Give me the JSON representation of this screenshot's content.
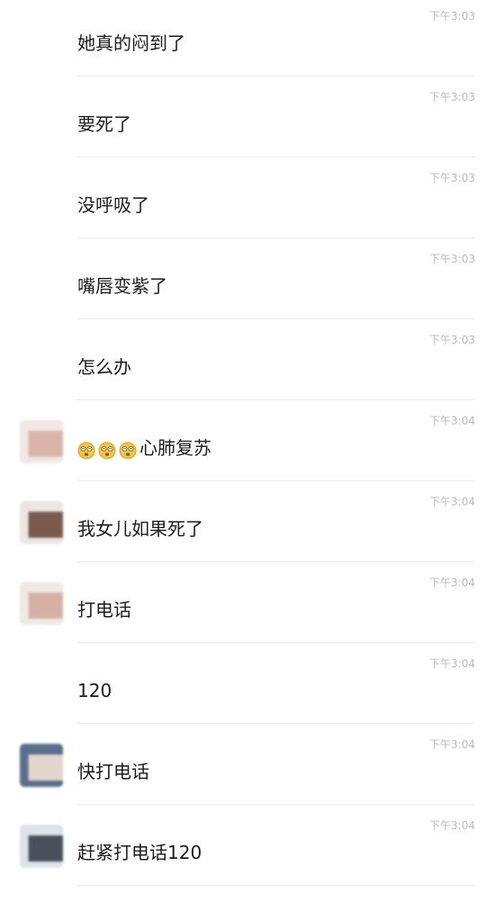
{
  "messages": [
    {
      "text": "她真的闷到了",
      "time": "下午3:03",
      "avatar_colors": []
    },
    {
      "text": "要死了",
      "time": "下午3:03",
      "avatar_colors": []
    },
    {
      "text": "没呼吸了",
      "time": "下午3:03",
      "avatar_colors": []
    },
    {
      "text": "嘴唇变紫了",
      "time": "下午3:03",
      "avatar_colors": []
    },
    {
      "text": "怎么办",
      "time": "下午3:03",
      "avatar_colors": []
    },
    {
      "text": "心肺复苏",
      "time": "下午3:04",
      "emoji_count": 3,
      "emoji_icon": "dizzy-face-emoji",
      "avatar_colors": [
        "#f0e8e4",
        "#d9b4a8"
      ]
    },
    {
      "text": "我女儿如果死了",
      "time": "下午3:04",
      "avatar_colors": [
        "#ece6e3",
        "#7a5a4e"
      ]
    },
    {
      "text": "打电话",
      "time": "下午3:04",
      "avatar_colors": [
        "#efe9e6",
        "#d6b0a4"
      ]
    },
    {
      "text": "120",
      "time": "下午3:04",
      "avatar_colors": []
    },
    {
      "text": "快打电话",
      "time": "下午3:04",
      "avatar_colors": [
        "#5a6f8c",
        "#e4d6cc"
      ]
    },
    {
      "text": "赶紧打电话120",
      "time": "下午3:04",
      "avatar_colors": [
        "#dfe2e8",
        "#4a4f5c"
      ]
    }
  ],
  "colors": {
    "text": "#1c1c1c",
    "timestamp": "#b9b9b9",
    "divider": "#ececec",
    "emoji_fill": "#f4c542"
  }
}
